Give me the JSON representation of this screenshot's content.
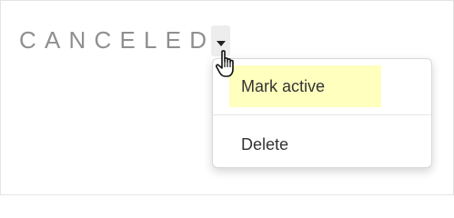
{
  "status": {
    "label": "CANCELED"
  },
  "dropdown": {
    "toggle_icon": "caret-down-icon",
    "items": [
      {
        "label": "Mark active",
        "highlighted": true,
        "highlight_color": "#ffffbe"
      },
      {
        "label": "Delete",
        "highlighted": false
      }
    ]
  },
  "cursor": {
    "icon": "hand-pointer-icon"
  },
  "colors": {
    "status_text": "#8f8f8f",
    "menu_text": "#333333",
    "toggle_background": "#ededed"
  }
}
